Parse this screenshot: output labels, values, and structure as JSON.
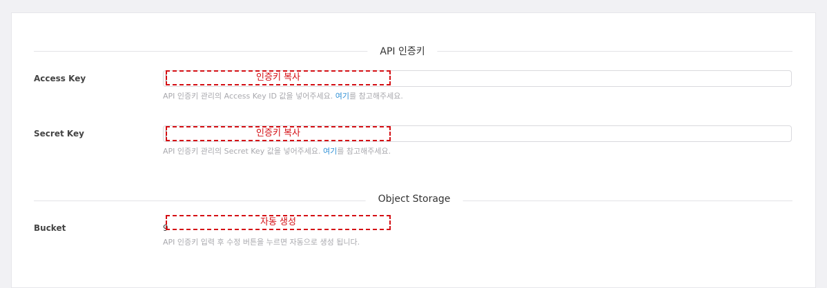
{
  "sections": {
    "api": {
      "title": "API 인증키"
    },
    "storage": {
      "title": "Object Storage"
    }
  },
  "access_key": {
    "label": "Access Key",
    "value": "",
    "hint_prefix": "API 인증키 관리의 Access Key ID 값을 넣어주세요. ",
    "hint_link": "여기",
    "hint_suffix": "를 참고해주세요."
  },
  "secret_key": {
    "label": "Secret Key",
    "value": "",
    "hint_prefix": "API 인증키 관리의 Secret Key 값을 넣어주세요. ",
    "hint_link": "여기",
    "hint_suffix": "를 참고해주세요."
  },
  "bucket": {
    "label": "Bucket",
    "value": "9",
    "hint": "API 인증키 입력 후 수정 버튼을 누르면 자동으로 생성 됩니다."
  },
  "annotations": {
    "access": "인증키 복사",
    "secret": "인증키 복사",
    "bucket": "자동 생성"
  },
  "colors": {
    "annotation": "#d40d12",
    "link": "#2d8fd5",
    "hint": "#a8a8ad"
  }
}
